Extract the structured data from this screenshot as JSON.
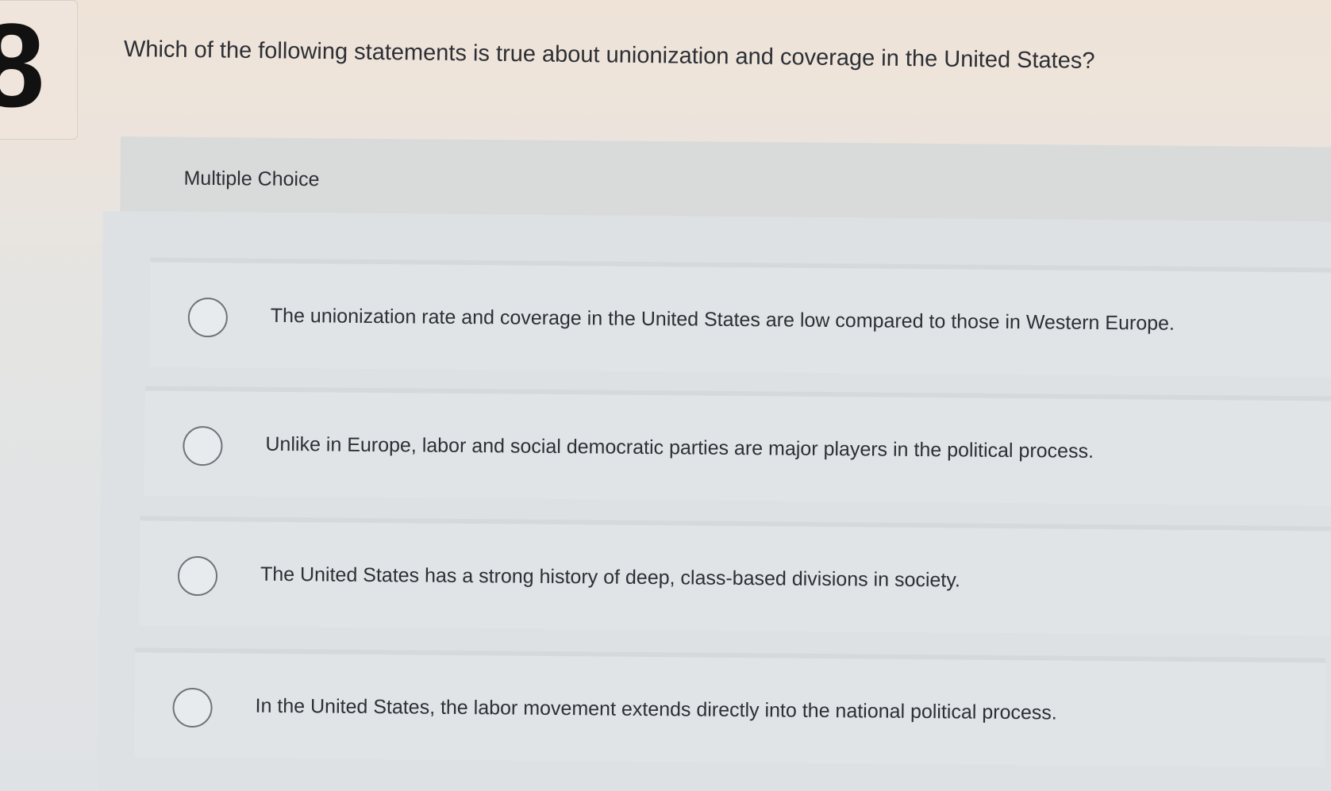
{
  "question": {
    "number": "8",
    "text": "Which of the following statements is true about unionization and coverage in the United States?"
  },
  "answer_area": {
    "type_label": "Multiple Choice",
    "options": [
      {
        "label": "The unionization rate and coverage in the United States are low compared to those in Western Europe.",
        "selected": false
      },
      {
        "label": "Unlike in Europe, labor and social democratic parties are major players in the political process.",
        "selected": false
      },
      {
        "label": "The United States has a strong history of deep, class-based divisions in society.",
        "selected": false
      },
      {
        "label": "In the United States, the labor movement extends directly into the national political process.",
        "selected": false
      }
    ]
  }
}
